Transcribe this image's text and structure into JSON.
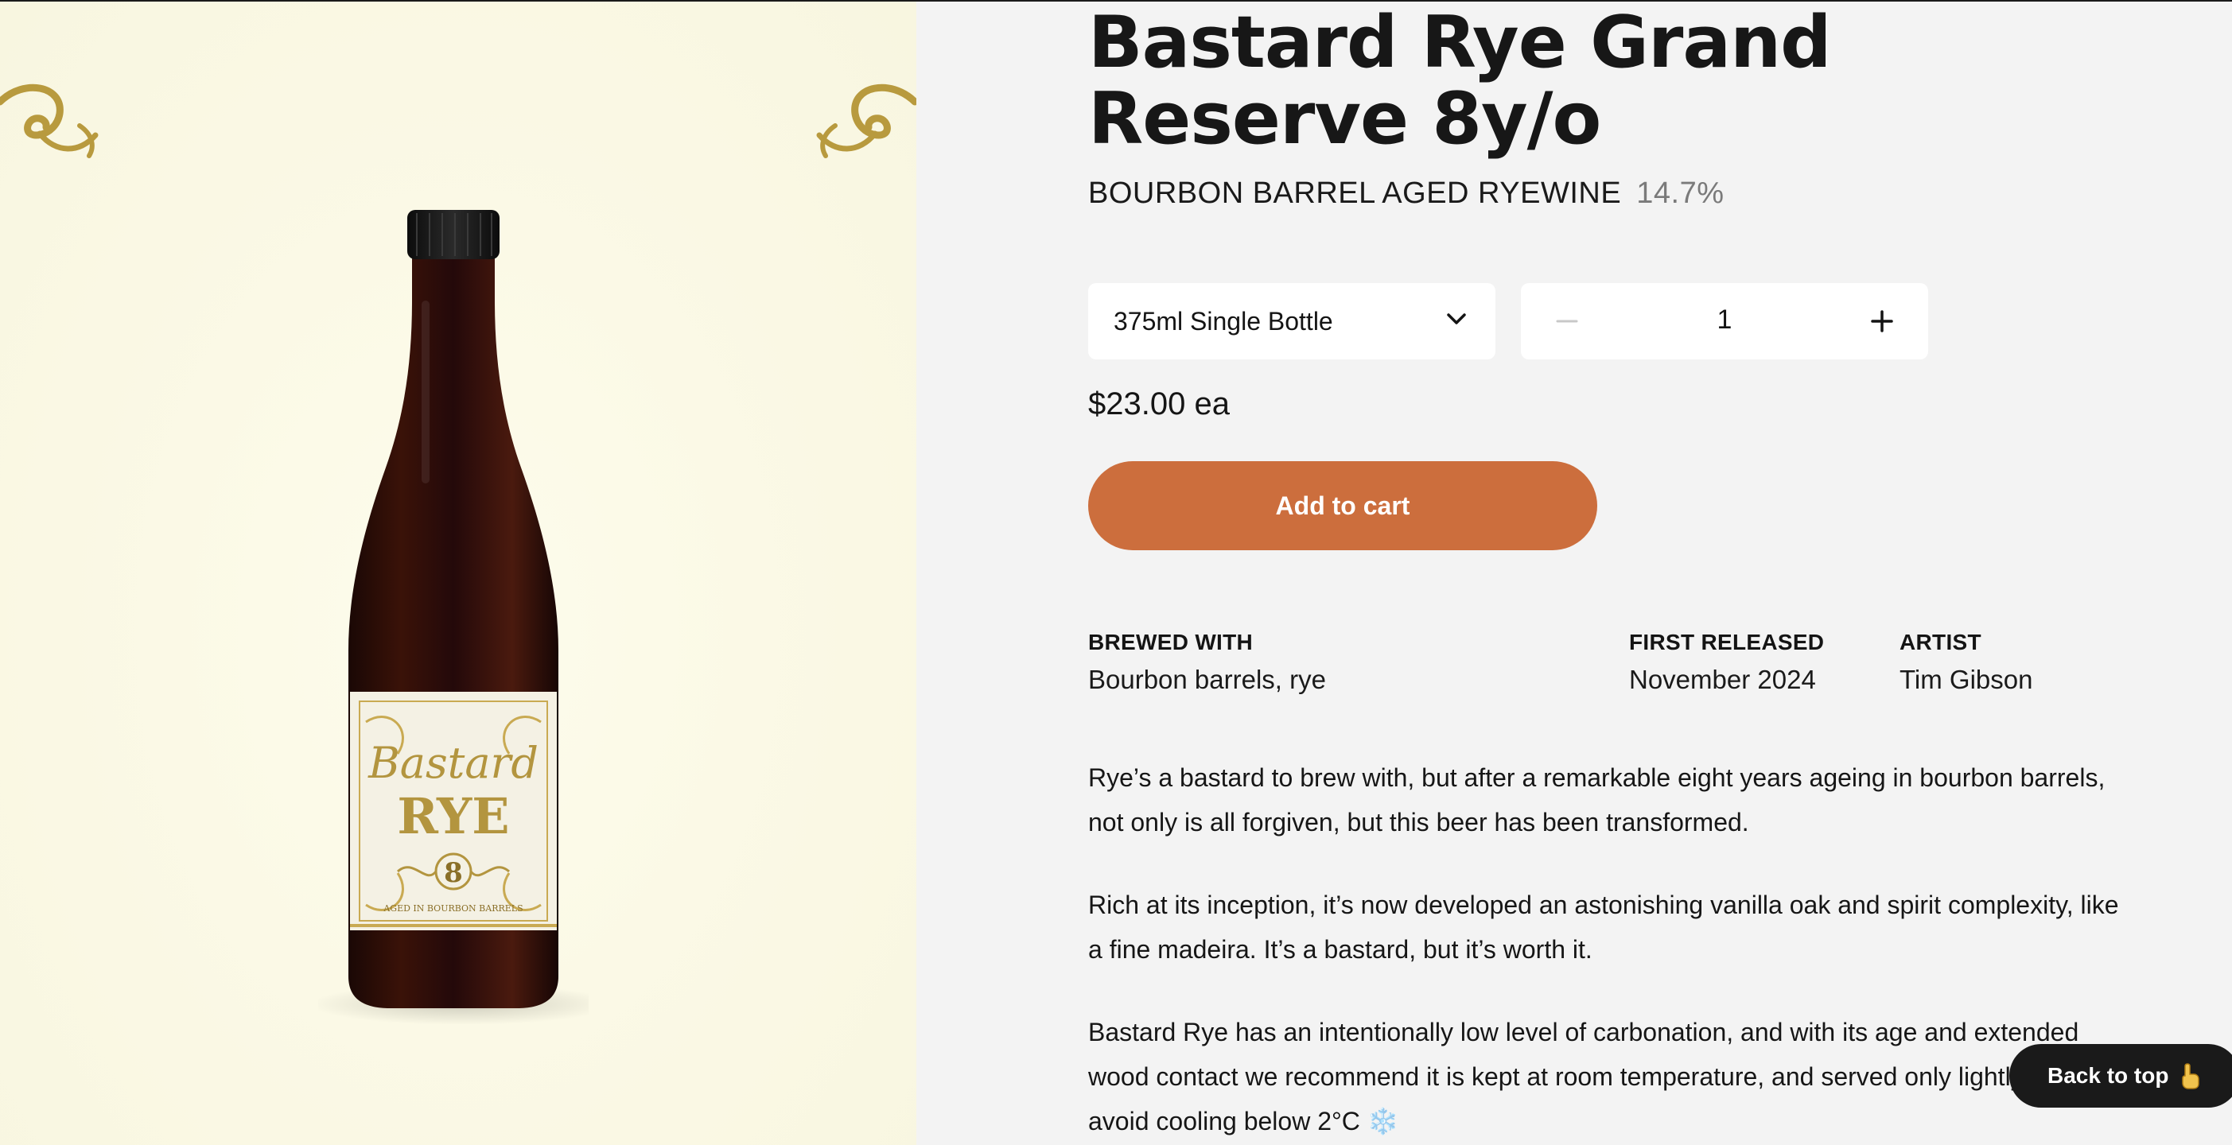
{
  "product": {
    "title": "Bastard Rye Grand Reserve 8y/o",
    "style": "BOURBON BARREL AGED RYEWINE",
    "abv": "14.7%",
    "image_label": {
      "line1": "Bastard",
      "line2": "RYE",
      "number": "8",
      "banner": "AGED IN BOURBON BARRELS"
    }
  },
  "purchase": {
    "format_selected": "375ml Single Bottle",
    "quantity": "1",
    "price": "$23.00 ea",
    "add_to_cart_label": "Add to cart"
  },
  "details": {
    "brewed_with_label": "BREWED WITH",
    "brewed_with_value": "Bourbon barrels, rye",
    "first_released_label": "FIRST RELEASED",
    "first_released_value": "November 2024",
    "artist_label": "ARTIST",
    "artist_value": "Tim Gibson"
  },
  "description": {
    "p1": "Rye’s a bastard to brew with, but after a remarkable eight years ageing in bourbon barrels, not only is all forgiven, but this beer has been transformed.",
    "p2": "Rich at its inception, it’s now developed an astonishing vanilla oak and spirit complexity, like a fine madeira. It’s a bastard, but it’s worth it.",
    "p3": "Bastard Rye has an intentionally low level of carbonation, and with its age and extended wood contact we recommend it is kept at room temperature, and served only lightly chilled – avoid cooling below 2°C ❄️"
  },
  "back_to_top": {
    "label": "Back to top",
    "icon": "pointing-up-hand-icon"
  },
  "colors": {
    "accent": "#cc6e3d",
    "panel_bg": "#fbf9e6",
    "page_bg": "#f3f3f3",
    "gold": "#b89a3e"
  }
}
